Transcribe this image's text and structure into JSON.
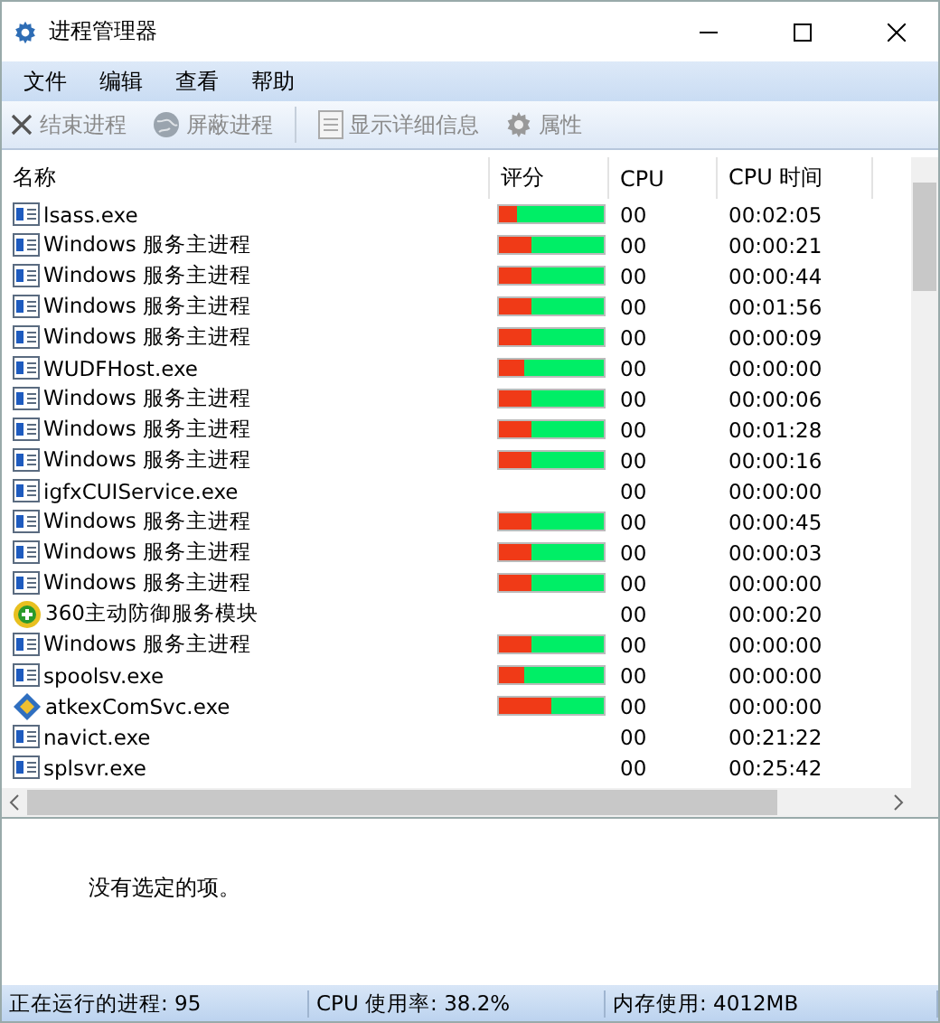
{
  "window": {
    "title": "进程管理器"
  },
  "menu": [
    "文件",
    "编辑",
    "查看",
    "帮助"
  ],
  "toolbar": [
    {
      "kind": "end",
      "label": "结束进程",
      "disabled": true
    },
    {
      "kind": "block",
      "label": "屏蔽进程",
      "disabled": true
    },
    {
      "kind": "details",
      "label": "显示详细信息",
      "disabled": true
    },
    {
      "kind": "props",
      "label": "属性",
      "disabled": true
    }
  ],
  "table": {
    "columns": [
      "名称",
      "评分",
      "CPU",
      "CPU 时间"
    ],
    "rows": [
      {
        "kind": "app",
        "name": "lsass.exe",
        "level": 0.17,
        "cpu": "00",
        "time": "00:02:05"
      },
      {
        "kind": "app",
        "name": "Windows 服务主进程",
        "level": 0.31,
        "cpu": "00",
        "time": "00:00:21"
      },
      {
        "kind": "app",
        "name": "Windows 服务主进程",
        "level": 0.31,
        "cpu": "00",
        "time": "00:00:44"
      },
      {
        "kind": "app",
        "name": "Windows 服务主进程",
        "level": 0.31,
        "cpu": "00",
        "time": "00:01:56"
      },
      {
        "kind": "app",
        "name": "Windows 服务主进程",
        "level": 0.31,
        "cpu": "00",
        "time": "00:00:09"
      },
      {
        "kind": "app",
        "name": "WUDFHost.exe",
        "level": 0.24,
        "cpu": "00",
        "time": "00:00:00"
      },
      {
        "kind": "app",
        "name": "Windows 服务主进程",
        "level": 0.31,
        "cpu": "00",
        "time": "00:00:06"
      },
      {
        "kind": "app",
        "name": "Windows 服务主进程",
        "level": 0.31,
        "cpu": "00",
        "time": "00:01:28"
      },
      {
        "kind": "app",
        "name": "Windows 服务主进程",
        "level": 0.31,
        "cpu": "00",
        "time": "00:00:16"
      },
      {
        "kind": "app",
        "name": "igfxCUIService.exe",
        "cpu": "00",
        "time": "00:00:00"
      },
      {
        "kind": "app",
        "name": "Windows 服务主进程",
        "level": 0.31,
        "cpu": "00",
        "time": "00:00:45"
      },
      {
        "kind": "app",
        "name": "Windows 服务主进程",
        "level": 0.31,
        "cpu": "00",
        "time": "00:00:03"
      },
      {
        "kind": "app",
        "name": "Windows 服务主进程",
        "level": 0.31,
        "cpu": "00",
        "time": "00:00:00"
      },
      {
        "kind": "shield",
        "name": "360主动防御服务模块",
        "cpu": "00",
        "time": "00:00:20"
      },
      {
        "kind": "app",
        "name": "Windows 服务主进程",
        "level": 0.31,
        "cpu": "00",
        "time": "00:00:00"
      },
      {
        "kind": "app",
        "name": "spoolsv.exe",
        "level": 0.24,
        "cpu": "00",
        "time": "00:00:00"
      },
      {
        "kind": "diamond",
        "name": "atkexComSvc.exe",
        "level": 0.5,
        "cpu": "00",
        "time": "00:00:00"
      },
      {
        "kind": "app",
        "name": "navict.exe",
        "cpu": "00",
        "time": "00:21:22"
      },
      {
        "kind": "app",
        "name": "splsvr.exe",
        "cpu": "00",
        "time": "00:25:42"
      }
    ]
  },
  "details": {
    "message": "没有选定的项。"
  },
  "status_bar": [
    "正在运行的进程: 95",
    "CPU 使用率: 38.2%",
    "内存使用: 4012MB"
  ]
}
